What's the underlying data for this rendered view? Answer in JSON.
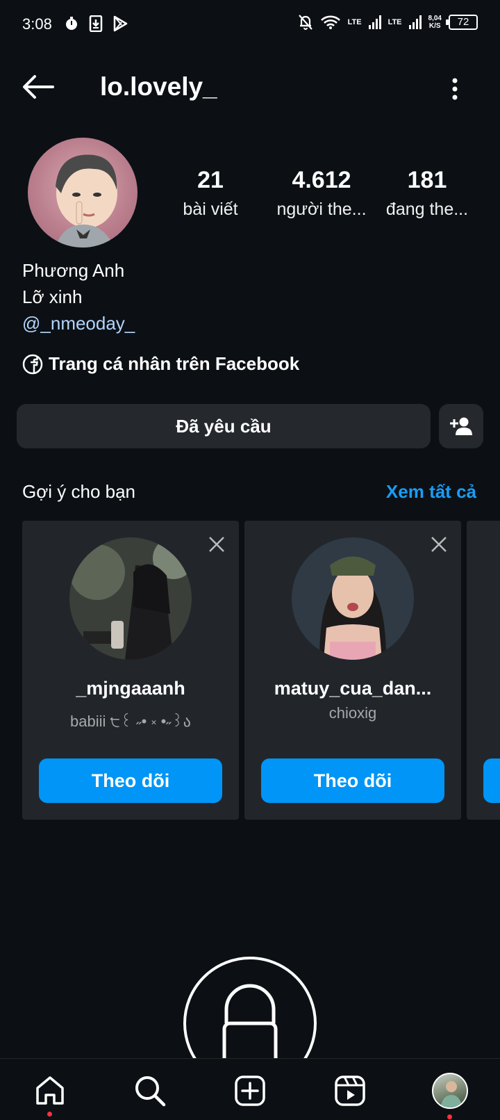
{
  "status_bar": {
    "time": "3:08",
    "lte1": "LTE",
    "lte2": "LTE",
    "speed_value": "8,04",
    "speed_unit": "K/S",
    "battery": "72"
  },
  "header": {
    "username": "lo.lovely_"
  },
  "profile": {
    "stats": [
      {
        "value": "21",
        "label": "bài viết"
      },
      {
        "value": "4.612",
        "label": "người the..."
      },
      {
        "value": "181",
        "label": "đang the..."
      }
    ],
    "full_name": "Phương Anh",
    "bio": "Lỡ xinh",
    "mention": "@_nmeoday_",
    "facebook_link": "Trang cá nhân trên Facebook"
  },
  "actions": {
    "requested_label": "Đã yêu cầu"
  },
  "suggestions": {
    "title": "Gợi ý cho bạn",
    "see_all": "Xem tất cả",
    "cards": [
      {
        "username": "_mjngaaanh",
        "subtitle": "babiii ੮꒰ ˶• ༝ •˶꒱ა",
        "follow_label": "Theo dõi"
      },
      {
        "username": "matuy_cua_dan...",
        "subtitle": "chioxig",
        "follow_label": "Theo dõi"
      }
    ]
  },
  "colors": {
    "background": "#0c1014",
    "accent": "#0095f6",
    "link": "#1a9cf5",
    "mention": "#b3d4fc",
    "notification_dot": "#ff3040"
  },
  "icons": {
    "back": "arrow-left-icon",
    "more": "more-vertical-icon",
    "facebook": "facebook-icon",
    "add_friend": "add-person-icon",
    "close": "close-icon",
    "lock": "lock-icon",
    "nav": [
      "home-icon",
      "search-icon",
      "create-icon",
      "reels-icon",
      "profile-avatar"
    ]
  }
}
